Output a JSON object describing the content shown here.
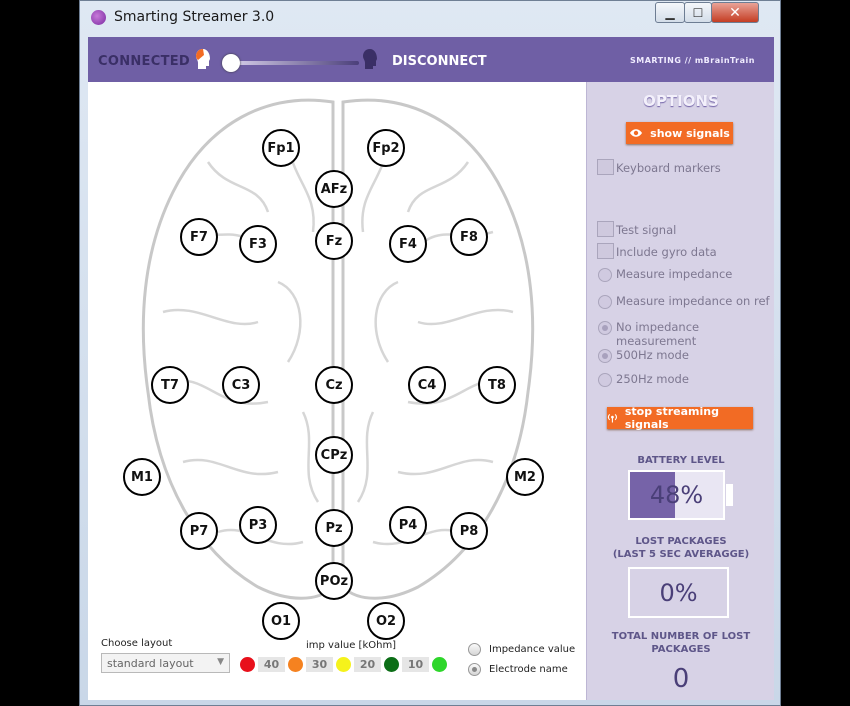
{
  "window": {
    "title": "Smarting Streamer 3.0",
    "minimize": "▁",
    "maximize": "☐",
    "close": "✕"
  },
  "header": {
    "connected": "CONNECTED",
    "disconnect": "DISCONNECT",
    "brand": "SMARTING // mBrainTrain"
  },
  "electrodes": [
    "Fp1",
    "Fp2",
    "AFz",
    "F7",
    "F3",
    "Fz",
    "F4",
    "F8",
    "T7",
    "C3",
    "Cz",
    "C4",
    "T8",
    "CPz",
    "M1",
    "M2",
    "P7",
    "P3",
    "Pz",
    "P4",
    "P8",
    "POz",
    "O1",
    "O2"
  ],
  "layout": {
    "choose_label": "Choose layout",
    "selected": "standard layout"
  },
  "impedance": {
    "label": "imp value [kOhm]",
    "scale": [
      "40",
      "30",
      "20",
      "10"
    ],
    "colors": [
      "#e8101b",
      "#f58220",
      "#f5f21b",
      "#0c6e17",
      "#2ed62b"
    ]
  },
  "display_mode": {
    "options": [
      "Impedance value",
      "Electrode name"
    ],
    "selected": "Electrode name"
  },
  "options": {
    "title": "OPTIONS",
    "show_signals": "show signals",
    "keyboard_markers": "Keyboard markers",
    "test_signal": "Test signal",
    "include_gyro": "Include gyro data",
    "measure_impedance": "Measure impedance",
    "measure_impedance_ref": "Measure impedance on ref",
    "no_impedance": "No impedance measurement",
    "mode_500": "500Hz mode",
    "mode_250": "250Hz mode",
    "stop_streaming": "stop streaming signals",
    "accent": "#f26b24"
  },
  "battery": {
    "label": "BATTERY LEVEL",
    "level": "48%",
    "fraction": 0.48
  },
  "lost": {
    "label_line1": "LOST PACKAGES",
    "label_line2": "(LAST 5 SEC AVERAGGE)",
    "value": "0%"
  },
  "total": {
    "label_line1": "TOTAL NUMBER OF LOST",
    "label_line2": "PACKAGES",
    "value": "0"
  }
}
